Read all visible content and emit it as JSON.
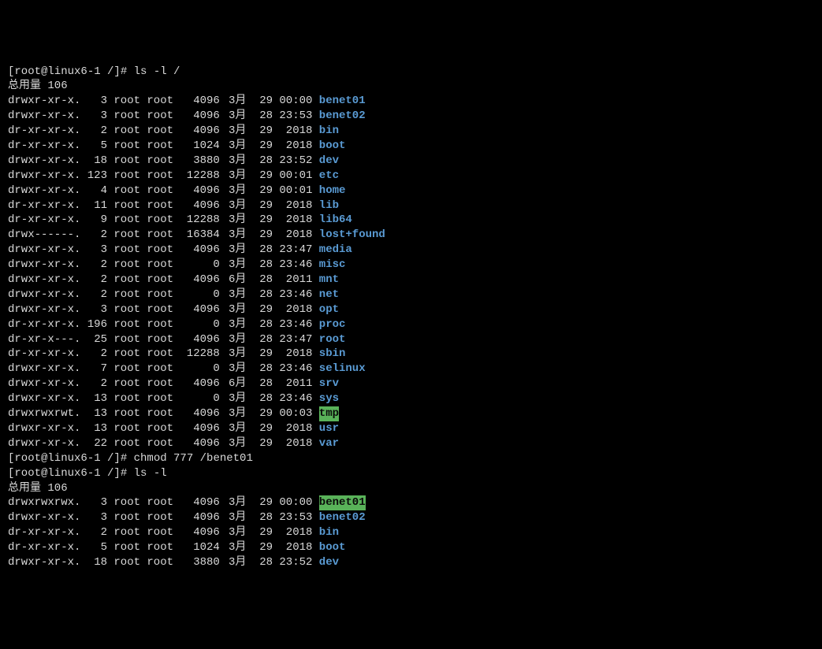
{
  "block1": {
    "prompt": "[root@linux6-1 /]# ls -l /",
    "header": "总用量 106",
    "rows": [
      {
        "perm": "drwxr-xr-x.",
        "links": "3",
        "owner": "root",
        "group": "root",
        "size": "4096",
        "mon": "3月",
        "day": "29",
        "time": "00:00",
        "name": "benet01",
        "style": "dir"
      },
      {
        "perm": "drwxr-xr-x.",
        "links": "3",
        "owner": "root",
        "group": "root",
        "size": "4096",
        "mon": "3月",
        "day": "28",
        "time": "23:53",
        "name": "benet02",
        "style": "dir"
      },
      {
        "perm": "dr-xr-xr-x.",
        "links": "2",
        "owner": "root",
        "group": "root",
        "size": "4096",
        "mon": "3月",
        "day": "29",
        "time": "2018",
        "name": "bin",
        "style": "dir"
      },
      {
        "perm": "dr-xr-xr-x.",
        "links": "5",
        "owner": "root",
        "group": "root",
        "size": "1024",
        "mon": "3月",
        "day": "29",
        "time": "2018",
        "name": "boot",
        "style": "dir"
      },
      {
        "perm": "drwxr-xr-x.",
        "links": "18",
        "owner": "root",
        "group": "root",
        "size": "3880",
        "mon": "3月",
        "day": "28",
        "time": "23:52",
        "name": "dev",
        "style": "dir"
      },
      {
        "perm": "drwxr-xr-x.",
        "links": "123",
        "owner": "root",
        "group": "root",
        "size": "12288",
        "mon": "3月",
        "day": "29",
        "time": "00:01",
        "name": "etc",
        "style": "dir"
      },
      {
        "perm": "drwxr-xr-x.",
        "links": "4",
        "owner": "root",
        "group": "root",
        "size": "4096",
        "mon": "3月",
        "day": "29",
        "time": "00:01",
        "name": "home",
        "style": "dir"
      },
      {
        "perm": "dr-xr-xr-x.",
        "links": "11",
        "owner": "root",
        "group": "root",
        "size": "4096",
        "mon": "3月",
        "day": "29",
        "time": "2018",
        "name": "lib",
        "style": "dir"
      },
      {
        "perm": "dr-xr-xr-x.",
        "links": "9",
        "owner": "root",
        "group": "root",
        "size": "12288",
        "mon": "3月",
        "day": "29",
        "time": "2018",
        "name": "lib64",
        "style": "dir"
      },
      {
        "perm": "drwx------.",
        "links": "2",
        "owner": "root",
        "group": "root",
        "size": "16384",
        "mon": "3月",
        "day": "29",
        "time": "2018",
        "name": "lost+found",
        "style": "dir"
      },
      {
        "perm": "drwxr-xr-x.",
        "links": "3",
        "owner": "root",
        "group": "root",
        "size": "4096",
        "mon": "3月",
        "day": "28",
        "time": "23:47",
        "name": "media",
        "style": "dir"
      },
      {
        "perm": "drwxr-xr-x.",
        "links": "2",
        "owner": "root",
        "group": "root",
        "size": "0",
        "mon": "3月",
        "day": "28",
        "time": "23:46",
        "name": "misc",
        "style": "dir"
      },
      {
        "perm": "drwxr-xr-x.",
        "links": "2",
        "owner": "root",
        "group": "root",
        "size": "4096",
        "mon": "6月",
        "day": "28",
        "time": "2011",
        "name": "mnt",
        "style": "dir"
      },
      {
        "perm": "drwxr-xr-x.",
        "links": "2",
        "owner": "root",
        "group": "root",
        "size": "0",
        "mon": "3月",
        "day": "28",
        "time": "23:46",
        "name": "net",
        "style": "dir"
      },
      {
        "perm": "drwxr-xr-x.",
        "links": "3",
        "owner": "root",
        "group": "root",
        "size": "4096",
        "mon": "3月",
        "day": "29",
        "time": "2018",
        "name": "opt",
        "style": "dir"
      },
      {
        "perm": "dr-xr-xr-x.",
        "links": "196",
        "owner": "root",
        "group": "root",
        "size": "0",
        "mon": "3月",
        "day": "28",
        "time": "23:46",
        "name": "proc",
        "style": "dir"
      },
      {
        "perm": "dr-xr-x---.",
        "links": "25",
        "owner": "root",
        "group": "root",
        "size": "4096",
        "mon": "3月",
        "day": "28",
        "time": "23:47",
        "name": "root",
        "style": "dir"
      },
      {
        "perm": "dr-xr-xr-x.",
        "links": "2",
        "owner": "root",
        "group": "root",
        "size": "12288",
        "mon": "3月",
        "day": "29",
        "time": "2018",
        "name": "sbin",
        "style": "dir"
      },
      {
        "perm": "drwxr-xr-x.",
        "links": "7",
        "owner": "root",
        "group": "root",
        "size": "0",
        "mon": "3月",
        "day": "28",
        "time": "23:46",
        "name": "selinux",
        "style": "dir"
      },
      {
        "perm": "drwxr-xr-x.",
        "links": "2",
        "owner": "root",
        "group": "root",
        "size": "4096",
        "mon": "6月",
        "day": "28",
        "time": "2011",
        "name": "srv",
        "style": "dir"
      },
      {
        "perm": "drwxr-xr-x.",
        "links": "13",
        "owner": "root",
        "group": "root",
        "size": "0",
        "mon": "3月",
        "day": "28",
        "time": "23:46",
        "name": "sys",
        "style": "dir"
      },
      {
        "perm": "drwxrwxrwt.",
        "links": "13",
        "owner": "root",
        "group": "root",
        "size": "4096",
        "mon": "3月",
        "day": "29",
        "time": "00:03",
        "name": "tmp",
        "style": "hl"
      },
      {
        "perm": "drwxr-xr-x.",
        "links": "13",
        "owner": "root",
        "group": "root",
        "size": "4096",
        "mon": "3月",
        "day": "29",
        "time": "2018",
        "name": "usr",
        "style": "dir"
      },
      {
        "perm": "drwxr-xr-x.",
        "links": "22",
        "owner": "root",
        "group": "root",
        "size": "4096",
        "mon": "3月",
        "day": "29",
        "time": "2018",
        "name": "var",
        "style": "dir"
      }
    ]
  },
  "cmd_chmod": "[root@linux6-1 /]# chmod 777 /benet01",
  "block2": {
    "prompt": "[root@linux6-1 /]# ls -l",
    "header": "总用量 106",
    "rows": [
      {
        "perm": "drwxrwxrwx.",
        "links": "3",
        "owner": "root",
        "group": "root",
        "size": "4096",
        "mon": "3月",
        "day": "29",
        "time": "00:00",
        "name": "benet01",
        "style": "hl"
      },
      {
        "perm": "drwxr-xr-x.",
        "links": "3",
        "owner": "root",
        "group": "root",
        "size": "4096",
        "mon": "3月",
        "day": "28",
        "time": "23:53",
        "name": "benet02",
        "style": "dir"
      },
      {
        "perm": "dr-xr-xr-x.",
        "links": "2",
        "owner": "root",
        "group": "root",
        "size": "4096",
        "mon": "3月",
        "day": "29",
        "time": "2018",
        "name": "bin",
        "style": "dir"
      },
      {
        "perm": "dr-xr-xr-x.",
        "links": "5",
        "owner": "root",
        "group": "root",
        "size": "1024",
        "mon": "3月",
        "day": "29",
        "time": "2018",
        "name": "boot",
        "style": "dir"
      },
      {
        "perm": "drwxr-xr-x.",
        "links": "18",
        "owner": "root",
        "group": "root",
        "size": "3880",
        "mon": "3月",
        "day": "28",
        "time": "23:52",
        "name": "dev",
        "style": "dir"
      }
    ]
  }
}
